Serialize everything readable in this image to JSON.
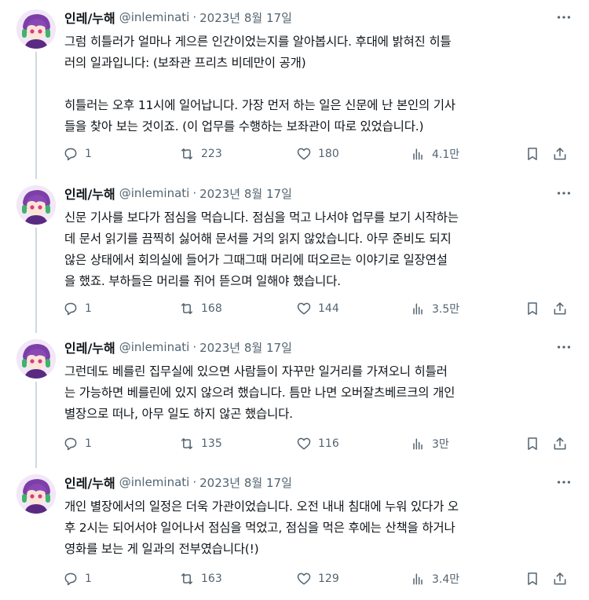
{
  "tweets": [
    {
      "name": "인레/누해",
      "handle": "@inleminati",
      "separator": "·",
      "date": "2023년 8월 17일",
      "lines": [
        "그럼 히틀러가 얼마나 게으른 인간이었는지를 알아봅시다. 후대에 밝혀진 히틀",
        "러의 일과입니다: (보좌관 프리츠 비데만이 공개)",
        "",
        "히틀러는 오후 11시에 일어납니다. 가장 먼저 하는 일은 신문에 난 본인의 기사",
        "들을 찾아 보는 것이죠. (이 업무를 수행하는 보좌관이 따로 있었습니다.)"
      ],
      "replies": "1",
      "retweets": "223",
      "likes": "180",
      "views": "4.1만"
    },
    {
      "name": "인레/누해",
      "handle": "@inleminati",
      "separator": "·",
      "date": "2023년 8월 17일",
      "lines": [
        "신문 기사를 보다가 점심을 먹습니다. 점심을 먹고 나서야 업무를 보기 시작하는",
        "데 문서 읽기를 끔찍히 싫어해 문서를 거의 읽지 않았습니다. 아무 준비도 되지",
        "않은 상태에서 회의실에 들어가 그때그때 머리에 떠오르는 이야기로 일장연설",
        "을 했죠. 부하들은 머리를 쥐어 뜯으며 일해야 했습니다."
      ],
      "replies": "1",
      "retweets": "168",
      "likes": "144",
      "views": "3.5만"
    },
    {
      "name": "인레/누해",
      "handle": "@inleminati",
      "separator": "·",
      "date": "2023년 8월 17일",
      "lines": [
        "그런데도 베를린 집무실에 있으면 사람들이 자꾸만 일거리를 가져오니 히틀러",
        "는 가능하면 베를린에 있지 않으려 했습니다. 틈만 나면 오버잘츠베르크의 개인",
        "별장으로 떠나, 아무 일도 하지 않곤 했습니다."
      ],
      "replies": "1",
      "retweets": "135",
      "likes": "116",
      "views": "3만"
    },
    {
      "name": "인레/누해",
      "handle": "@inleminati",
      "separator": "·",
      "date": "2023년 8월 17일",
      "lines": [
        "개인 별장에서의 일정은 더욱 가관이었습니다. 오전 내내 침대에 누워 있다가 오",
        "후 2시는 되어서야 일어나서 점심을 먹었고, 점심을 먹은 후에는 산책을 하거나",
        "영화를 보는 게 일과의 전부였습니다(!)"
      ],
      "replies": "1",
      "retweets": "163",
      "likes": "129",
      "views": "3.4만"
    }
  ]
}
